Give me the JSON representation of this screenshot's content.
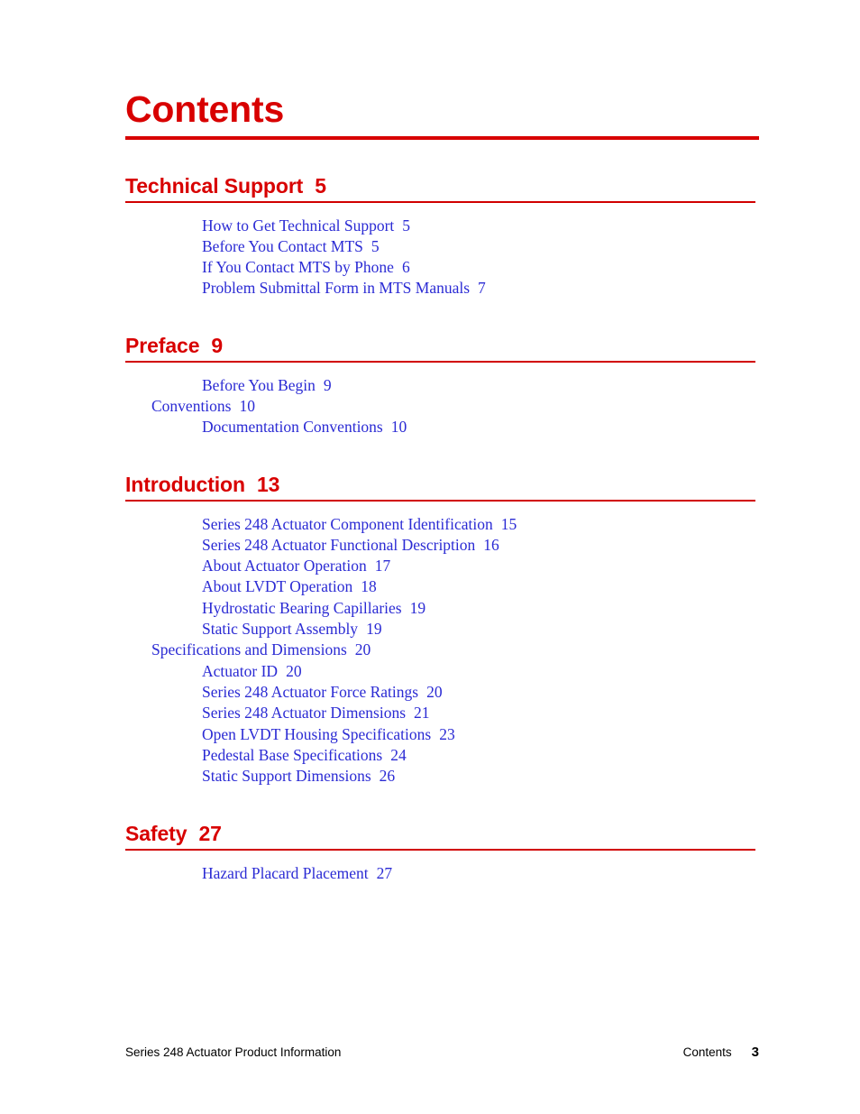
{
  "document": {
    "title": "Contents",
    "colors": {
      "heading_red": "#d80000",
      "link_blue": "#2b2bd4",
      "footer_black": "#000000"
    }
  },
  "sections": [
    {
      "name": "Technical Support",
      "page": "5",
      "entries": [
        {
          "label": "How to Get Technical Support",
          "page": "5",
          "level": 2
        },
        {
          "label": "Before You Contact MTS",
          "page": "5",
          "level": 2
        },
        {
          "label": "If You Contact MTS by Phone",
          "page": "6",
          "level": 2
        },
        {
          "label": "Problem Submittal Form in MTS Manuals",
          "page": "7",
          "level": 2
        }
      ]
    },
    {
      "name": "Preface",
      "page": "9",
      "entries": [
        {
          "label": "Before You Begin",
          "page": "9",
          "level": 2
        },
        {
          "label": "Conventions",
          "page": "10",
          "level": 1
        },
        {
          "label": "Documentation Conventions",
          "page": "10",
          "level": 2
        }
      ]
    },
    {
      "name": "Introduction",
      "page": "13",
      "entries": [
        {
          "label": "Series 248 Actuator Component Identification",
          "page": "15",
          "level": 2
        },
        {
          "label": "Series 248 Actuator Functional Description",
          "page": "16",
          "level": 2
        },
        {
          "label": "About Actuator Operation",
          "page": "17",
          "level": 2
        },
        {
          "label": "About LVDT Operation",
          "page": "18",
          "level": 2
        },
        {
          "label": "Hydrostatic Bearing Capillaries",
          "page": "19",
          "level": 2
        },
        {
          "label": "Static Support Assembly",
          "page": "19",
          "level": 2
        },
        {
          "label": "Specifications and Dimensions",
          "page": "20",
          "level": 1
        },
        {
          "label": "Actuator ID",
          "page": "20",
          "level": 2
        },
        {
          "label": "Series 248 Actuator Force Ratings",
          "page": "20",
          "level": 2
        },
        {
          "label": "Series 248 Actuator Dimensions",
          "page": "21",
          "level": 2
        },
        {
          "label": "Open LVDT Housing Specifications",
          "page": "23",
          "level": 2
        },
        {
          "label": "Pedestal Base Specifications",
          "page": "24",
          "level": 2
        },
        {
          "label": "Static Support Dimensions",
          "page": "26",
          "level": 2
        }
      ]
    },
    {
      "name": "Safety",
      "page": "27",
      "entries": [
        {
          "label": "Hazard Placard Placement",
          "page": "27",
          "level": 2
        }
      ]
    }
  ],
  "footer": {
    "left": "Series 248 Actuator Product Information",
    "label": "Contents",
    "page": "3"
  }
}
